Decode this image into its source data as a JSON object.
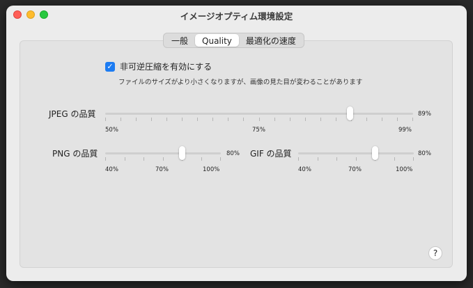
{
  "window": {
    "title": "イメージオプティム環境設定"
  },
  "tabs": [
    {
      "label": "一般"
    },
    {
      "label": "Quality"
    },
    {
      "label": "最適化の速度"
    }
  ],
  "lossy": {
    "checkbox_label": "非可逆圧縮を有効にする",
    "checked": true,
    "description": "ファイルのサイズがより小さくなりますが、画像の見た目が変わることがあります"
  },
  "jpeg": {
    "label": "JPEG の品質",
    "value_label": "89%",
    "value": 89,
    "min": 50,
    "max": 99,
    "marks": [
      "50%",
      "75%",
      "99%"
    ]
  },
  "png": {
    "label": "PNG の品質",
    "value_label": "80%",
    "value": 80,
    "min": 40,
    "max": 100,
    "marks": [
      "40%",
      "70%",
      "100%"
    ]
  },
  "gif": {
    "label": "GIF の品質",
    "value_label": "80%",
    "value": 80,
    "min": 40,
    "max": 100,
    "marks": [
      "40%",
      "70%",
      "100%"
    ]
  },
  "help": {
    "label": "?"
  },
  "colors": {
    "accent": "#1d7cf2",
    "window_bg": "#ececec",
    "panel_bg": "#e3e3e3"
  }
}
